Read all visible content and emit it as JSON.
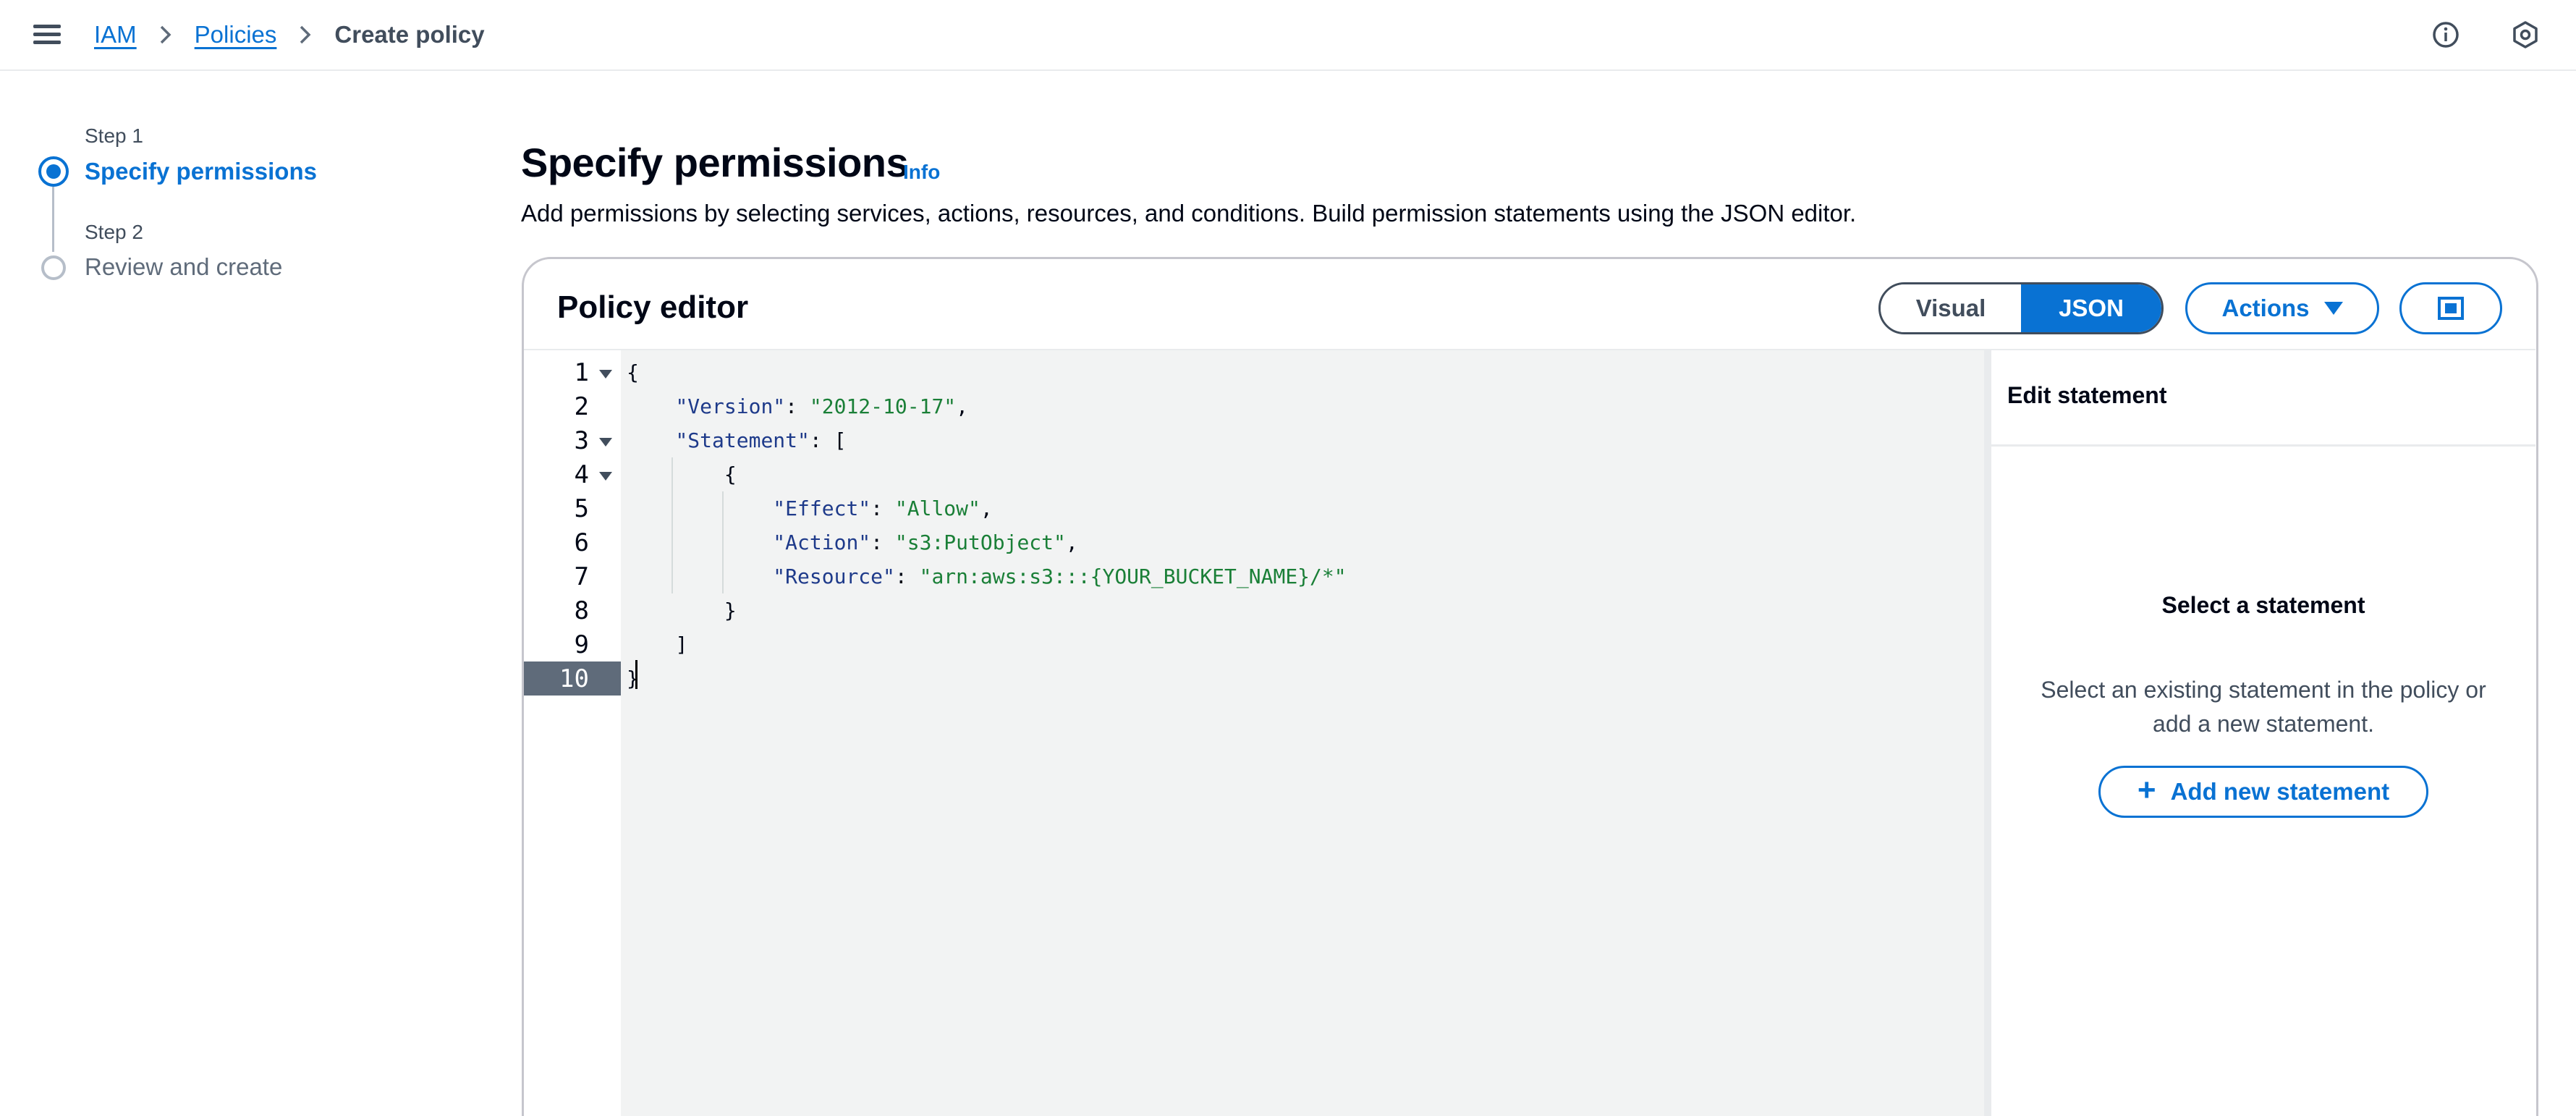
{
  "breadcrumb": {
    "items": [
      "IAM",
      "Policies"
    ],
    "current": "Create policy"
  },
  "icons": {
    "menu": "hamburger-menu-icon",
    "info": "info-circle-icon",
    "settings": "hexagon-settings-icon"
  },
  "steps": [
    {
      "label": "Step 1",
      "title": "Specify permissions",
      "active": true
    },
    {
      "label": "Step 2",
      "title": "Review and create",
      "active": false
    }
  ],
  "header": {
    "title": "Specify permissions",
    "info_link": "Info",
    "description": "Add permissions by selecting services, actions, resources, and conditions. Build permission statements using the JSON editor."
  },
  "policy_editor": {
    "title": "Policy editor",
    "segmented": {
      "visual": "Visual",
      "json": "JSON",
      "selected": "JSON"
    },
    "actions_label": "Actions",
    "line_numbers": [
      "1",
      "2",
      "3",
      "4",
      "5",
      "6",
      "7",
      "8",
      "9",
      "10"
    ],
    "current_line": "10",
    "code": {
      "l1": "{",
      "l2_key": "\"Version\"",
      "l2_sep": ": ",
      "l2_val": "\"2012-10-17\"",
      "l2_end": ",",
      "l3_key": "\"Statement\"",
      "l3_rest": ": [",
      "l4": "{",
      "l5_key": "\"Effect\"",
      "l5_sep": ": ",
      "l5_val": "\"Allow\"",
      "l5_end": ",",
      "l6_key": "\"Action\"",
      "l6_sep": ": ",
      "l6_val": "\"s3:PutObject\"",
      "l6_end": ",",
      "l7_key": "\"Resource\"",
      "l7_sep": ": ",
      "l7_val": "\"arn:aws:s3:::{YOUR_BUCKET_NAME}/*\"",
      "l8": "}",
      "l9": "]",
      "l10": "}"
    }
  },
  "side_panel": {
    "title": "Edit statement",
    "empty_title": "Select a statement",
    "empty_desc": "Select an existing statement in the policy or add a new statement.",
    "add_button": "Add new statement"
  },
  "colors": {
    "accent": "#0972d3",
    "text": "#000716",
    "muted": "#414d5c",
    "border": "#c6c6cd",
    "editor_bg": "#f2f3f3",
    "string": "#1a7f37",
    "key": "#1e3a8a"
  }
}
